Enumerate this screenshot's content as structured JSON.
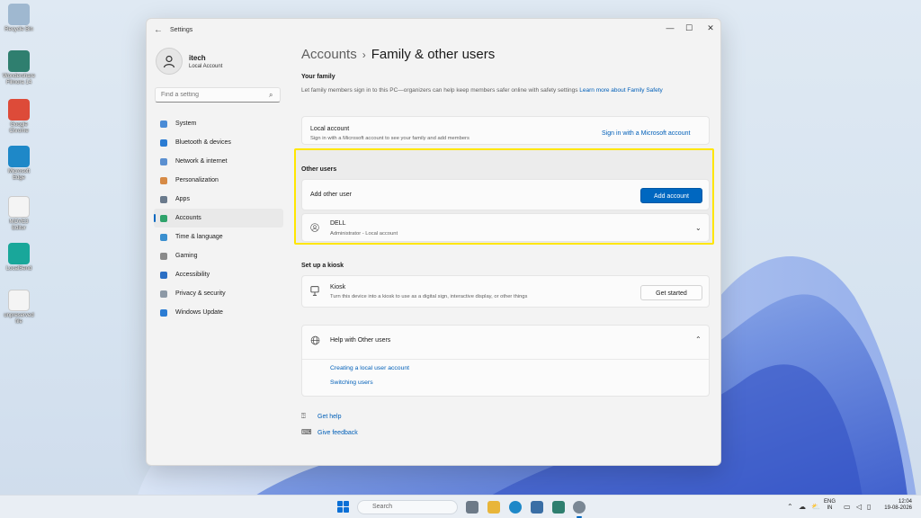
{
  "desktop": {
    "icons": [
      {
        "label": "Recycle Bin",
        "icon": "recycle-bin-icon",
        "color": "#9fb8d0"
      },
      {
        "label": "Wondershare Filmora 14",
        "icon": "filmora-icon",
        "color": "#2f7f6f"
      },
      {
        "label": "Google Chrome",
        "icon": "chrome-icon",
        "color": "#dd4b39"
      },
      {
        "label": "Microsoft Edge",
        "icon": "edge-icon",
        "color": "#1e88c8"
      },
      {
        "label": "MOVE3 Editor",
        "icon": "file-icon",
        "color": "#f4f4f4"
      },
      {
        "label": "LocalSend",
        "icon": "localsend-icon",
        "color": "#19a79a"
      },
      {
        "label": "unpreserved file",
        "icon": "file-icon",
        "color": "#f4f4f4"
      }
    ]
  },
  "window": {
    "title": "Settings",
    "back_glyph": "←",
    "controls": {
      "minimize": "—",
      "maximize": "☐",
      "close": "✕"
    }
  },
  "profile": {
    "name": "itech",
    "subtitle": "Local Account"
  },
  "search": {
    "placeholder": "Find a setting"
  },
  "nav": {
    "items": [
      {
        "label": "System",
        "icon": "monitor-icon",
        "color": "#4a8bd6"
      },
      {
        "label": "Bluetooth & devices",
        "icon": "bluetooth-icon",
        "color": "#2b7cd3"
      },
      {
        "label": "Network & internet",
        "icon": "wifi-icon",
        "color": "#5a8fd0"
      },
      {
        "label": "Personalization",
        "icon": "brush-icon",
        "color": "#d68a45"
      },
      {
        "label": "Apps",
        "icon": "apps-icon",
        "color": "#6a7a8c"
      },
      {
        "label": "Accounts",
        "icon": "person-icon",
        "color": "#2fa36b"
      },
      {
        "label": "Time & language",
        "icon": "globe-clock-icon",
        "color": "#3a8fcf"
      },
      {
        "label": "Gaming",
        "icon": "controller-icon",
        "color": "#8a8a8a"
      },
      {
        "label": "Accessibility",
        "icon": "accessibility-icon",
        "color": "#2b6fc4"
      },
      {
        "label": "Privacy & security",
        "icon": "shield-icon",
        "color": "#8d99a6"
      },
      {
        "label": "Windows Update",
        "icon": "update-icon",
        "color": "#2b7cd3"
      }
    ],
    "active_index": 5
  },
  "breadcrumb": {
    "parent": "Accounts",
    "separator": "›",
    "current": "Family & other users"
  },
  "family": {
    "heading": "Your family",
    "description": "Let family members sign in to this PC—organizers can help keep members safer online with safety settings",
    "link": "Learn more about Family Safety",
    "card_title": "Local account",
    "card_sub": "Sign in with a Microsoft account to see your family and add members",
    "card_action": "Sign in with a Microsoft account"
  },
  "other_users": {
    "heading": "Other users",
    "add_label": "Add other user",
    "add_button": "Add account",
    "user_name": "DELL",
    "user_sub": "Administrator - Local account"
  },
  "kiosk": {
    "heading": "Set up a kiosk",
    "title": "Kiosk",
    "sub": "Turn this device into a kiosk to use as a digital sign, interactive display, or other things",
    "button": "Get started"
  },
  "help": {
    "title": "Help with Other users",
    "links": [
      "Creating a local user account",
      "Switching users"
    ]
  },
  "footer": {
    "get_help": "Get help",
    "give_feedback": "Give feedback"
  },
  "taskbar": {
    "search_placeholder": "Search",
    "lang_top": "ENG",
    "lang_bottom": "IN",
    "time": "12:04",
    "date": "19-08-2026",
    "accent": "#0067c0"
  }
}
